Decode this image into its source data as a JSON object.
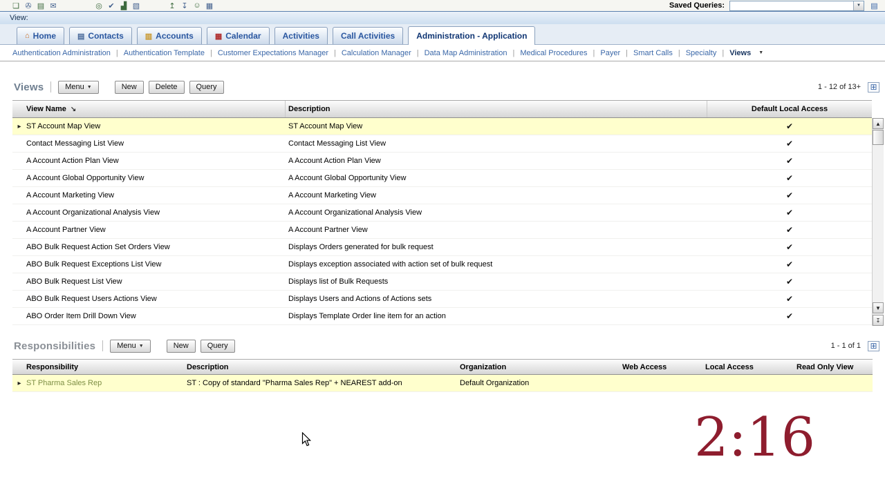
{
  "toolbar": {
    "icons": [
      {
        "name": "open-icon",
        "glyph": "❏"
      },
      {
        "name": "save-icon",
        "glyph": "✇"
      },
      {
        "name": "print-icon",
        "glyph": "▤"
      },
      {
        "name": "email-icon",
        "glyph": "✉"
      },
      {
        "name": "search-icon",
        "glyph": "◎"
      },
      {
        "name": "spell-check-icon",
        "glyph": "✔"
      },
      {
        "name": "chart-icon",
        "glyph": "▟"
      },
      {
        "name": "report-icon",
        "glyph": "▧"
      },
      {
        "name": "export-icon",
        "glyph": "↥"
      },
      {
        "name": "import-icon",
        "glyph": "↧"
      },
      {
        "name": "help-icon",
        "glyph": "☺"
      },
      {
        "name": "applications-icon",
        "glyph": "▦"
      }
    ],
    "saved_queries_label": "Saved Queries:",
    "saved_queries_value": "",
    "combo_caret": "▼",
    "saved_query_icon_glyph": "▤"
  },
  "viewbar": {
    "label": "View:"
  },
  "tabs": [
    {
      "label": "Home",
      "glyph": "⌂"
    },
    {
      "label": "Contacts",
      "glyph": "▤"
    },
    {
      "label": "Accounts",
      "glyph": "▥"
    },
    {
      "label": "Calendar",
      "glyph": "▦"
    },
    {
      "label": "Activities"
    },
    {
      "label": "Call Activities"
    },
    {
      "label": "Administration - Application"
    }
  ],
  "subnav": {
    "separator": "|",
    "caret": "▼",
    "items": [
      "Authentication Administration",
      "Authentication Template",
      "Customer Expectations Manager",
      "Calculation Manager",
      "Data Map Administration",
      "Medical Procedures",
      "Payer",
      "Smart Calls",
      "Specialty",
      "Views"
    ]
  },
  "ui": {
    "row_arrow": "▸"
  },
  "scrollbar": {
    "up": "▲",
    "down": "▼",
    "end": "↧"
  },
  "views": {
    "title": "Views",
    "menu_label": "Menu",
    "buttons": {
      "new": "New",
      "delete": "Delete",
      "query": "Query"
    },
    "pagination": "1 - 12 of 13+",
    "sort_glyph": "↘",
    "columns": {
      "name": "View Name",
      "description": "Description",
      "access": "Default Local Access"
    },
    "rows": [
      {
        "name": "ST Account Map View",
        "description": "ST Account Map View",
        "check": "✔"
      },
      {
        "name": "Contact Messaging List View",
        "description": "Contact Messaging List View",
        "check": "✔"
      },
      {
        "name": "A Account Action Plan View",
        "description": "A Account Action Plan View",
        "check": "✔"
      },
      {
        "name": "A Account Global Opportunity View",
        "description": "A Account Global Opportunity View",
        "check": "✔"
      },
      {
        "name": "A Account Marketing View",
        "description": "A Account Marketing View",
        "check": "✔"
      },
      {
        "name": "A Account Organizational Analysis View",
        "description": "A Account Organizational Analysis View",
        "check": "✔"
      },
      {
        "name": "A Account Partner View",
        "description": "A Account Partner View",
        "check": "✔"
      },
      {
        "name": "ABO Bulk Request Action Set Orders View",
        "description": "Displays Orders generated for bulk request",
        "check": "✔"
      },
      {
        "name": "ABO Bulk Request Exceptions List View",
        "description": "Displays exception associated with action set of bulk request",
        "check": "✔"
      },
      {
        "name": "ABO Bulk Request List View",
        "description": "Displays list of Bulk Requests",
        "check": "✔"
      },
      {
        "name": "ABO Bulk Request Users Actions View",
        "description": "Displays Users and Actions of Actions sets",
        "check": "✔"
      },
      {
        "name": "ABO Order Item Drill Down View",
        "description": "Displays Template Order line item for an action",
        "check": "✔"
      }
    ]
  },
  "responsibilities": {
    "title": "Responsibilities",
    "menu_label": "Menu",
    "buttons": {
      "new": "New",
      "query": "Query"
    },
    "pagination": "1 - 1 of 1",
    "columns": {
      "responsibility": "Responsibility",
      "description": "Description",
      "organization": "Organization",
      "web_access": "Web Access",
      "local_access": "Local Access",
      "read_only": "Read Only View"
    },
    "rows": [
      {
        "responsibility": "ST Pharma Sales Rep",
        "description": "ST : Copy of standard \"Pharma Sales Rep\" + NEAREST add-on",
        "organization": "Default Organization"
      }
    ]
  },
  "overlay": {
    "timer": "2:16"
  }
}
